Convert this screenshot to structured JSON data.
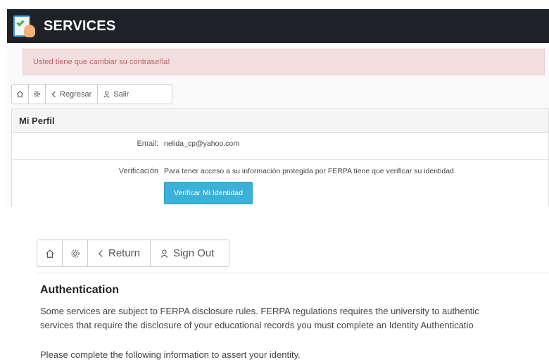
{
  "spanish_view": {
    "app_title": "SERVICES",
    "alert_text": "Usted tiene que cambiar su contraseña!",
    "toolbar": {
      "back_label": "Regresar",
      "logout_label": "Salir"
    },
    "panel_title": "Mi Perfil",
    "email_label": "Email:",
    "email_value": "nelida_cp@yahoo.com",
    "verification_label": "Verificación",
    "verification_text": "Para tener acceso a su información protegida por FERPA tiene que verificar su identidad.",
    "verify_button": "Verificar Mi Identidad"
  },
  "english_view": {
    "toolbar": {
      "return_label": "Return",
      "signout_label": "Sign Out"
    },
    "heading": "Authentication",
    "paragraph_line1": "Some services are subject to FERPA disclosure rules. FERPA regulations requires the university to authentic",
    "paragraph_line2": "services that require the disclosure of your educational records you must complete an Identity Authenticatio",
    "instruction": "Please complete the following information to assert your identity."
  },
  "colors": {
    "header_bg": "#1e2126",
    "alert_bg": "#f2dede",
    "alert_text": "#c0626a",
    "button_accent": "#3bb0d9"
  },
  "icons": [
    "home-icon",
    "settings-icon",
    "chevron-left-icon",
    "user-icon"
  ]
}
